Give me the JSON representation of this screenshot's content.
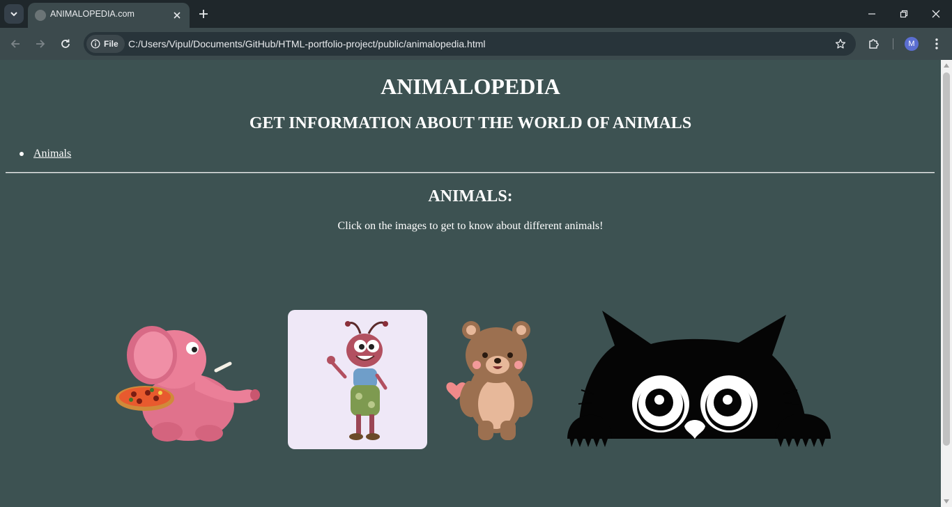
{
  "browser": {
    "tab_title": "ANIMALOPEDIA.com",
    "address_chip": "File",
    "url": "C:/Users/Vipul/Documents/GitHub/HTML-portfolio-project/public/animalopedia.html",
    "profile_initial": "M"
  },
  "page": {
    "title": "ANIMALOPEDIA",
    "subtitle": "GET INFORMATION ABOUT THE WORLD OF ANIMALS",
    "nav": [
      {
        "label": "Animals"
      }
    ],
    "section_title": "ANIMALS:",
    "instruction": "Click on the images to get to know about different animals!",
    "animals": [
      {
        "name": "elephant",
        "icon": "pink-elephant-with-pizza"
      },
      {
        "name": "ant",
        "icon": "cartoon-ant"
      },
      {
        "name": "bear",
        "icon": "teddy-bear-with-heart"
      },
      {
        "name": "cat",
        "icon": "peeking-black-cat"
      }
    ]
  },
  "colors": {
    "page_background": "#3d5252",
    "browser_frame": "#3c4a4d",
    "tab_strip": "#1f272b",
    "text": "#ffffff"
  }
}
